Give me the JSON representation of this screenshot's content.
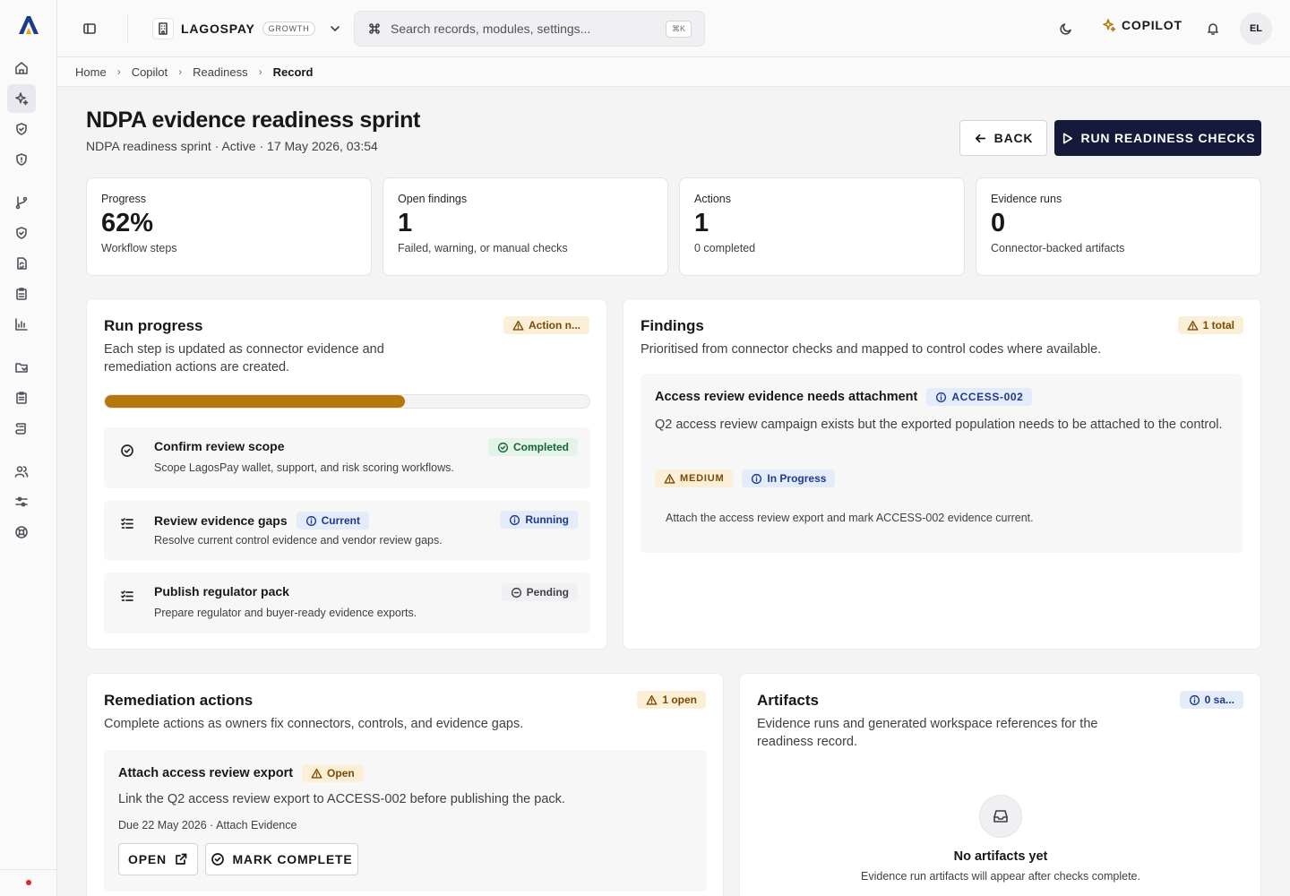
{
  "topbar": {
    "org_name": "LAGOSPAY",
    "plan": "GROWTH",
    "search_placeholder": "Search records, modules, settings...",
    "search_shortcut": "⌘K",
    "copilot_label": "COPILOT",
    "avatar_initials": "EL"
  },
  "breadcrumb": [
    "Home",
    "Copilot",
    "Readiness",
    "Record"
  ],
  "page": {
    "title": "NDPA evidence readiness sprint",
    "subtitle": "NDPA readiness sprint · Active · 17 May 2026, 03:54",
    "back_label": "BACK",
    "run_label": "RUN READINESS CHECKS"
  },
  "stats": [
    {
      "label": "Progress",
      "value": "62%",
      "sub": "Workflow steps"
    },
    {
      "label": "Open findings",
      "value": "1",
      "sub": "Failed, warning, or manual checks"
    },
    {
      "label": "Actions",
      "value": "1",
      "sub": "0 completed"
    },
    {
      "label": "Evidence runs",
      "value": "0",
      "sub": "Connector-backed artifacts"
    }
  ],
  "run_progress": {
    "title": "Run progress",
    "badge": "Action n...",
    "description": "Each step is updated as connector evidence and remediation actions are created.",
    "progress_fraction": 0.62,
    "steps": [
      {
        "title": "Confirm review scope",
        "tag": "",
        "status": "Completed",
        "description": "Scope LagosPay wallet, support, and risk scoring workflows."
      },
      {
        "title": "Review evidence gaps",
        "tag": "Current",
        "status": "Running",
        "description": "Resolve current control evidence and vendor review gaps."
      },
      {
        "title": "Publish regulator pack",
        "tag": "",
        "status": "Pending",
        "description": "Prepare regulator and buyer-ready evidence exports."
      }
    ]
  },
  "findings": {
    "title": "Findings",
    "badge": "1 total",
    "description": "Prioritised from connector checks and mapped to control codes where available.",
    "item": {
      "title": "Access review evidence needs attachment",
      "code": "ACCESS-002",
      "description": "Q2 access review campaign exists but the exported population needs to be attached to the control.",
      "severity": "MEDIUM",
      "status": "In Progress",
      "note": "Attach the access review export and mark ACCESS-002 evidence current."
    }
  },
  "remediation": {
    "title": "Remediation actions",
    "badge": "1 open",
    "description": "Complete actions as owners fix connectors, controls, and evidence gaps.",
    "item": {
      "title": "Attach access review export",
      "status": "Open",
      "description": "Link the Q2 access review export to ACCESS-002 before publishing the pack.",
      "due": "Due 22 May 2026 · Attach Evidence",
      "open_label": "OPEN",
      "complete_label": "MARK COMPLETE"
    }
  },
  "artifacts": {
    "title": "Artifacts",
    "badge": "0 sa...",
    "description": "Evidence runs and generated workspace references for the readiness record.",
    "empty_title": "No artifacts yet",
    "empty_desc": "Evidence run artifacts will appear after checks complete."
  },
  "colors": {
    "primary": "#151a3b",
    "progress": "#b6780a",
    "warning": "#7c4a03",
    "info": "#1e3a8a",
    "success": "#166534"
  }
}
